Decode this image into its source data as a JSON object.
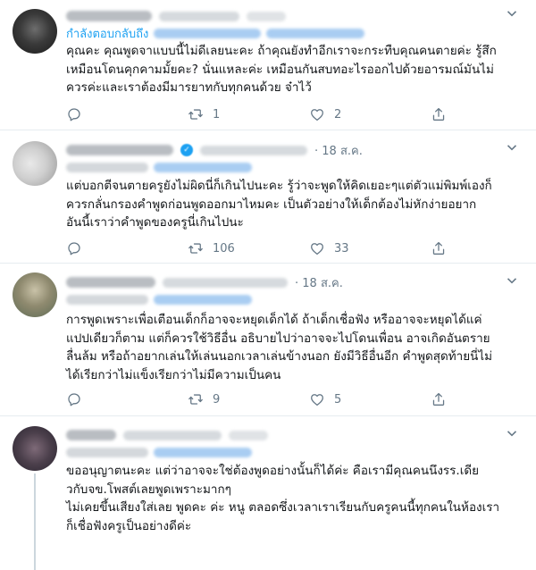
{
  "tweets": [
    {
      "reply_label": "กำลังตอบกลับถึง",
      "text": [
        "คุณคะ คุณพูดจาแบบนี้ไม่ดีเลยนะคะ ถ้าคุณยังทำอีกเราจะกระทืบคุณคนตายค่ะ  รู้สึก",
        "เหมือนโดนคุกคามมั้ยคะ?  นั่นแหละค่ะ เหมือนกันสบทอะไรออกไปด้วยอารมณ์มันไม่",
        "ควรค่ะและเราต้องมีมารยาทกับทุกคนด้วย จ๋าไว้"
      ],
      "reply_count": "",
      "retweet_count": "1",
      "like_count": "2",
      "share_count": ""
    },
    {
      "date": "· 18 ส.ค.",
      "text": [
        "แต่บอกตีจนตายครูยังไม่ผิดนี่ก็เกินไปนะคะ รู้ว่าจะพูดให้คิดเยอะๆแต่ตัวแม่พิมพ์เองก็",
        "ควรกลั่นกรองคำพูดก่อนพูดออกมาไหมคะ เป็นตัวอย่างให้เด็กต้องไม่หักง่ายอยาก",
        "อันนี้เราว่าคำพูดของครูนี่เกินไปนะ"
      ],
      "reply_count": "",
      "retweet_count": "106",
      "like_count": "33",
      "share_count": ""
    },
    {
      "date": "· 18 ส.ค.",
      "text": [
        "การพูดเพราะเพื่อเตือนเด็กก็อาจจะหยุดเด็กได้ ถ้าเด็กเชื่อฟัง หรืออาจจะหยุดได้แค่",
        "แปปเดียวก็ตาม แต่ก็ควรใช้วิธีอื่น อธิบายไปว่าอาจจะไปโดนเพื่อน อาจเกิดอันตราย",
        "ลื่นล้ม หรือถ้าอยากเล่นให้เล่นนอกเวลาเล่นข้างนอก ยังมีวิธีอื่นอีก คำพูดสุดท้ายนี่ไม่",
        "ได้เรียกว่าไม่แข็งเรียกว่าไม่มีความเป็นคน"
      ],
      "reply_count": "",
      "retweet_count": "9",
      "like_count": "5",
      "share_count": ""
    },
    {
      "text": [
        "ขออนุญาตนะคะ แต่ว่าอาจจะใช่ต้องพูดอย่างนั้นก็ได้ค่ะ คือเรามีคุณคนนึงรร.เดีย",
        "วกับจข.โพสต์เลยพูดเพราะมากๆ",
        "ไม่เคยขึ้นเสียงใส่เลย พูดคะ ค่ะ หนู ตลอดซึ่งเวลาเราเรียนกับครูคนนี้ทุกคนในห้องเรา",
        "ก็เชื่อฟังครูเป็นอย่างดีค่ะ"
      ]
    }
  ],
  "icons": [
    "caret-down-icon",
    "reply-icon",
    "retweet-icon",
    "like-icon",
    "share-icon",
    "verified-badge-icon"
  ],
  "colors": {
    "link_blue": "#1da1f2",
    "muted_gray": "#657786",
    "border": "#e6ecf0"
  }
}
